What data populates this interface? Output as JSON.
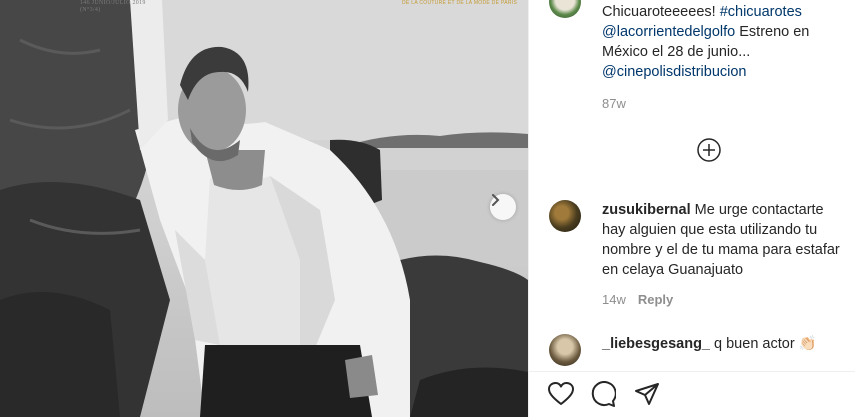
{
  "post_image": {
    "magazine_issue": "146 JUNIO/JULIO 2019",
    "magazine_issue_sub": "(N°3/4)",
    "magazine_tagline": "DE LA COUTURE ET DE LA MODE DE PARIS",
    "next_icon": "chevron-right-icon"
  },
  "caption": {
    "line1_text": "Chicuaroteeeees! ",
    "hashtag": "#chicuarotes",
    "mention1": "@lacorrientedelgolfo",
    "line2_text": " Estreno en",
    "line3_text": "México el 28 de junio...",
    "mention2": "@cinepolisdistribucion",
    "time": "87w"
  },
  "load_more_icon": "plus-circle-icon",
  "comments": [
    {
      "username": "zusukibernal",
      "line1": " Me urge contactarte",
      "line2": "hay alguien que esta utilizando tu",
      "line3": "nombre y el de tu mama para estafar",
      "line4": "en celaya Guanajuato",
      "time": "14w",
      "reply_label": "Reply"
    },
    {
      "username": "_liebesgesang_",
      "text": " q buen actor 👏🏻"
    }
  ],
  "actions": {
    "like_icon": "heart-icon",
    "comment_icon": "comment-icon",
    "share_icon": "paper-plane-icon"
  },
  "colors": {
    "link": "#00376b",
    "muted": "#8e8e8e",
    "text": "#262626"
  }
}
